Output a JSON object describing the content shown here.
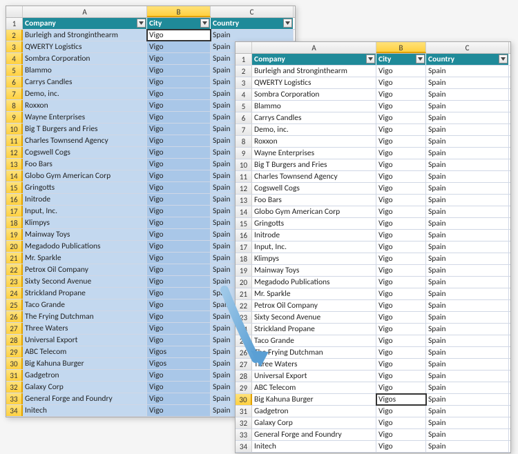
{
  "columns": {
    "a": "A",
    "b": "B",
    "c": "C"
  },
  "headers": {
    "company": "Company",
    "city": "City",
    "country": "Country"
  },
  "left": {
    "active_row": 2,
    "rows": [
      {
        "n": 2,
        "company": "Burleigh and Stronginthearm",
        "city": "Vigo",
        "country": "Spain"
      },
      {
        "n": 3,
        "company": "QWERTY Logistics",
        "city": "Vigo",
        "country": "Spain"
      },
      {
        "n": 4,
        "company": "Sombra Corporation",
        "city": "Vigo",
        "country": "Spain"
      },
      {
        "n": 5,
        "company": "Blammo",
        "city": "Vigo",
        "country": "Spain"
      },
      {
        "n": 6,
        "company": "Carrys Candles",
        "city": "Vigo",
        "country": "Spain"
      },
      {
        "n": 7,
        "company": "Demo, inc.",
        "city": "Vigo",
        "country": "Spain"
      },
      {
        "n": 8,
        "company": "Roxxon",
        "city": "Vigo",
        "country": "Spain"
      },
      {
        "n": 9,
        "company": "Wayne Enterprises",
        "city": "Vigo",
        "country": "Spain"
      },
      {
        "n": 10,
        "company": "Big T Burgers and Fries",
        "city": "Vigo",
        "country": "Spain"
      },
      {
        "n": 11,
        "company": "Charles Townsend Agency",
        "city": "Vigo",
        "country": "Spain"
      },
      {
        "n": 12,
        "company": "Cogswell Cogs",
        "city": "Vigo",
        "country": "Spain"
      },
      {
        "n": 13,
        "company": "Foo Bars",
        "city": "Vigo",
        "country": "Spain"
      },
      {
        "n": 14,
        "company": "Globo Gym American Corp",
        "city": "Vigo",
        "country": "Spain"
      },
      {
        "n": 15,
        "company": "Gringotts",
        "city": "Vigo",
        "country": "Spain"
      },
      {
        "n": 16,
        "company": "Initrode",
        "city": "Vigo",
        "country": "Spain"
      },
      {
        "n": 17,
        "company": "Input, Inc.",
        "city": "Vigo",
        "country": "Spain"
      },
      {
        "n": 18,
        "company": "Klimpys",
        "city": "Vigo",
        "country": "Spain"
      },
      {
        "n": 19,
        "company": "Mainway Toys",
        "city": "Vigo",
        "country": "Spain"
      },
      {
        "n": 20,
        "company": "Megadodo Publications",
        "city": "Vigo",
        "country": "Spain"
      },
      {
        "n": 21,
        "company": "Mr. Sparkle",
        "city": "Vigo",
        "country": "Spain"
      },
      {
        "n": 22,
        "company": "Petrox Oil Company",
        "city": "Vigo",
        "country": "Spain"
      },
      {
        "n": 23,
        "company": "Sixty Second Avenue",
        "city": "Vigo",
        "country": "Spain"
      },
      {
        "n": 24,
        "company": "Strickland Propane",
        "city": "Vigo",
        "country": "Spain"
      },
      {
        "n": 25,
        "company": "Taco Grande",
        "city": "Vigo",
        "country": "Spain"
      },
      {
        "n": 26,
        "company": "The Frying Dutchman",
        "city": "Vigo",
        "country": "Spain"
      },
      {
        "n": 27,
        "company": "Three Waters",
        "city": "Vigo",
        "country": "Spain"
      },
      {
        "n": 28,
        "company": "Universal Export",
        "city": "Vigo",
        "country": "Spain"
      },
      {
        "n": 29,
        "company": "ABC Telecom",
        "city": "Vigos",
        "country": "Spain"
      },
      {
        "n": 30,
        "company": "Big Kahuna Burger",
        "city": "Vigos",
        "country": "Spain"
      },
      {
        "n": 31,
        "company": "Gadgetron",
        "city": "Vigo",
        "country": "Spain"
      },
      {
        "n": 32,
        "company": "Galaxy Corp",
        "city": "Vigo",
        "country": "Spain"
      },
      {
        "n": 33,
        "company": "General Forge and Foundry",
        "city": "Vigo",
        "country": "Spain"
      },
      {
        "n": 34,
        "company": "Initech",
        "city": "Vigo",
        "country": "Spain"
      }
    ]
  },
  "right": {
    "active_row": 30,
    "rows": [
      {
        "n": 2,
        "company": "Burleigh and Stronginthearm",
        "city": "Vigo",
        "country": "Spain"
      },
      {
        "n": 3,
        "company": "QWERTY Logistics",
        "city": "Vigo",
        "country": "Spain"
      },
      {
        "n": 4,
        "company": "Sombra Corporation",
        "city": "Vigo",
        "country": "Spain"
      },
      {
        "n": 5,
        "company": "Blammo",
        "city": "Vigo",
        "country": "Spain"
      },
      {
        "n": 6,
        "company": "Carrys Candles",
        "city": "Vigo",
        "country": "Spain"
      },
      {
        "n": 7,
        "company": "Demo, inc.",
        "city": "Vigo",
        "country": "Spain"
      },
      {
        "n": 8,
        "company": "Roxxon",
        "city": "Vigo",
        "country": "Spain"
      },
      {
        "n": 9,
        "company": "Wayne Enterprises",
        "city": "Vigo",
        "country": "Spain"
      },
      {
        "n": 10,
        "company": "Big T Burgers and Fries",
        "city": "Vigo",
        "country": "Spain"
      },
      {
        "n": 11,
        "company": "Charles Townsend Agency",
        "city": "Vigo",
        "country": "Spain"
      },
      {
        "n": 12,
        "company": "Cogswell Cogs",
        "city": "Vigo",
        "country": "Spain"
      },
      {
        "n": 13,
        "company": "Foo Bars",
        "city": "Vigo",
        "country": "Spain"
      },
      {
        "n": 14,
        "company": "Globo Gym American Corp",
        "city": "Vigo",
        "country": "Spain"
      },
      {
        "n": 15,
        "company": "Gringotts",
        "city": "Vigo",
        "country": "Spain"
      },
      {
        "n": 16,
        "company": "Initrode",
        "city": "Vigo",
        "country": "Spain"
      },
      {
        "n": 17,
        "company": "Input, Inc.",
        "city": "Vigo",
        "country": "Spain"
      },
      {
        "n": 18,
        "company": "Klimpys",
        "city": "Vigo",
        "country": "Spain"
      },
      {
        "n": 19,
        "company": "Mainway Toys",
        "city": "Vigo",
        "country": "Spain"
      },
      {
        "n": 20,
        "company": "Megadodo Publications",
        "city": "Vigo",
        "country": "Spain"
      },
      {
        "n": 21,
        "company": "Mr. Sparkle",
        "city": "Vigo",
        "country": "Spain"
      },
      {
        "n": 22,
        "company": "Petrox Oil Company",
        "city": "Vigo",
        "country": "Spain"
      },
      {
        "n": 23,
        "company": "Sixty Second Avenue",
        "city": "Vigo",
        "country": "Spain"
      },
      {
        "n": 24,
        "company": "Strickland Propane",
        "city": "Vigo",
        "country": "Spain"
      },
      {
        "n": 25,
        "company": "Taco Grande",
        "city": "Vigo",
        "country": "Spain"
      },
      {
        "n": 26,
        "company": "The Frying Dutchman",
        "city": "Vigo",
        "country": "Spain"
      },
      {
        "n": 27,
        "company": "Three Waters",
        "city": "Vigo",
        "country": "Spain"
      },
      {
        "n": 28,
        "company": "Universal Export",
        "city": "Vigo",
        "country": "Spain"
      },
      {
        "n": 29,
        "company": "ABC Telecom",
        "city": "Vigo",
        "country": "Spain"
      },
      {
        "n": 30,
        "company": "Big Kahuna Burger",
        "city": "Vigos",
        "country": "Spain"
      },
      {
        "n": 31,
        "company": "Gadgetron",
        "city": "Vigo",
        "country": "Spain"
      },
      {
        "n": 32,
        "company": "Galaxy Corp",
        "city": "Vigo",
        "country": "Spain"
      },
      {
        "n": 33,
        "company": "General Forge and Foundry",
        "city": "Vigo",
        "country": "Spain"
      },
      {
        "n": 34,
        "company": "Initech",
        "city": "Vigo",
        "country": "Spain"
      }
    ]
  }
}
